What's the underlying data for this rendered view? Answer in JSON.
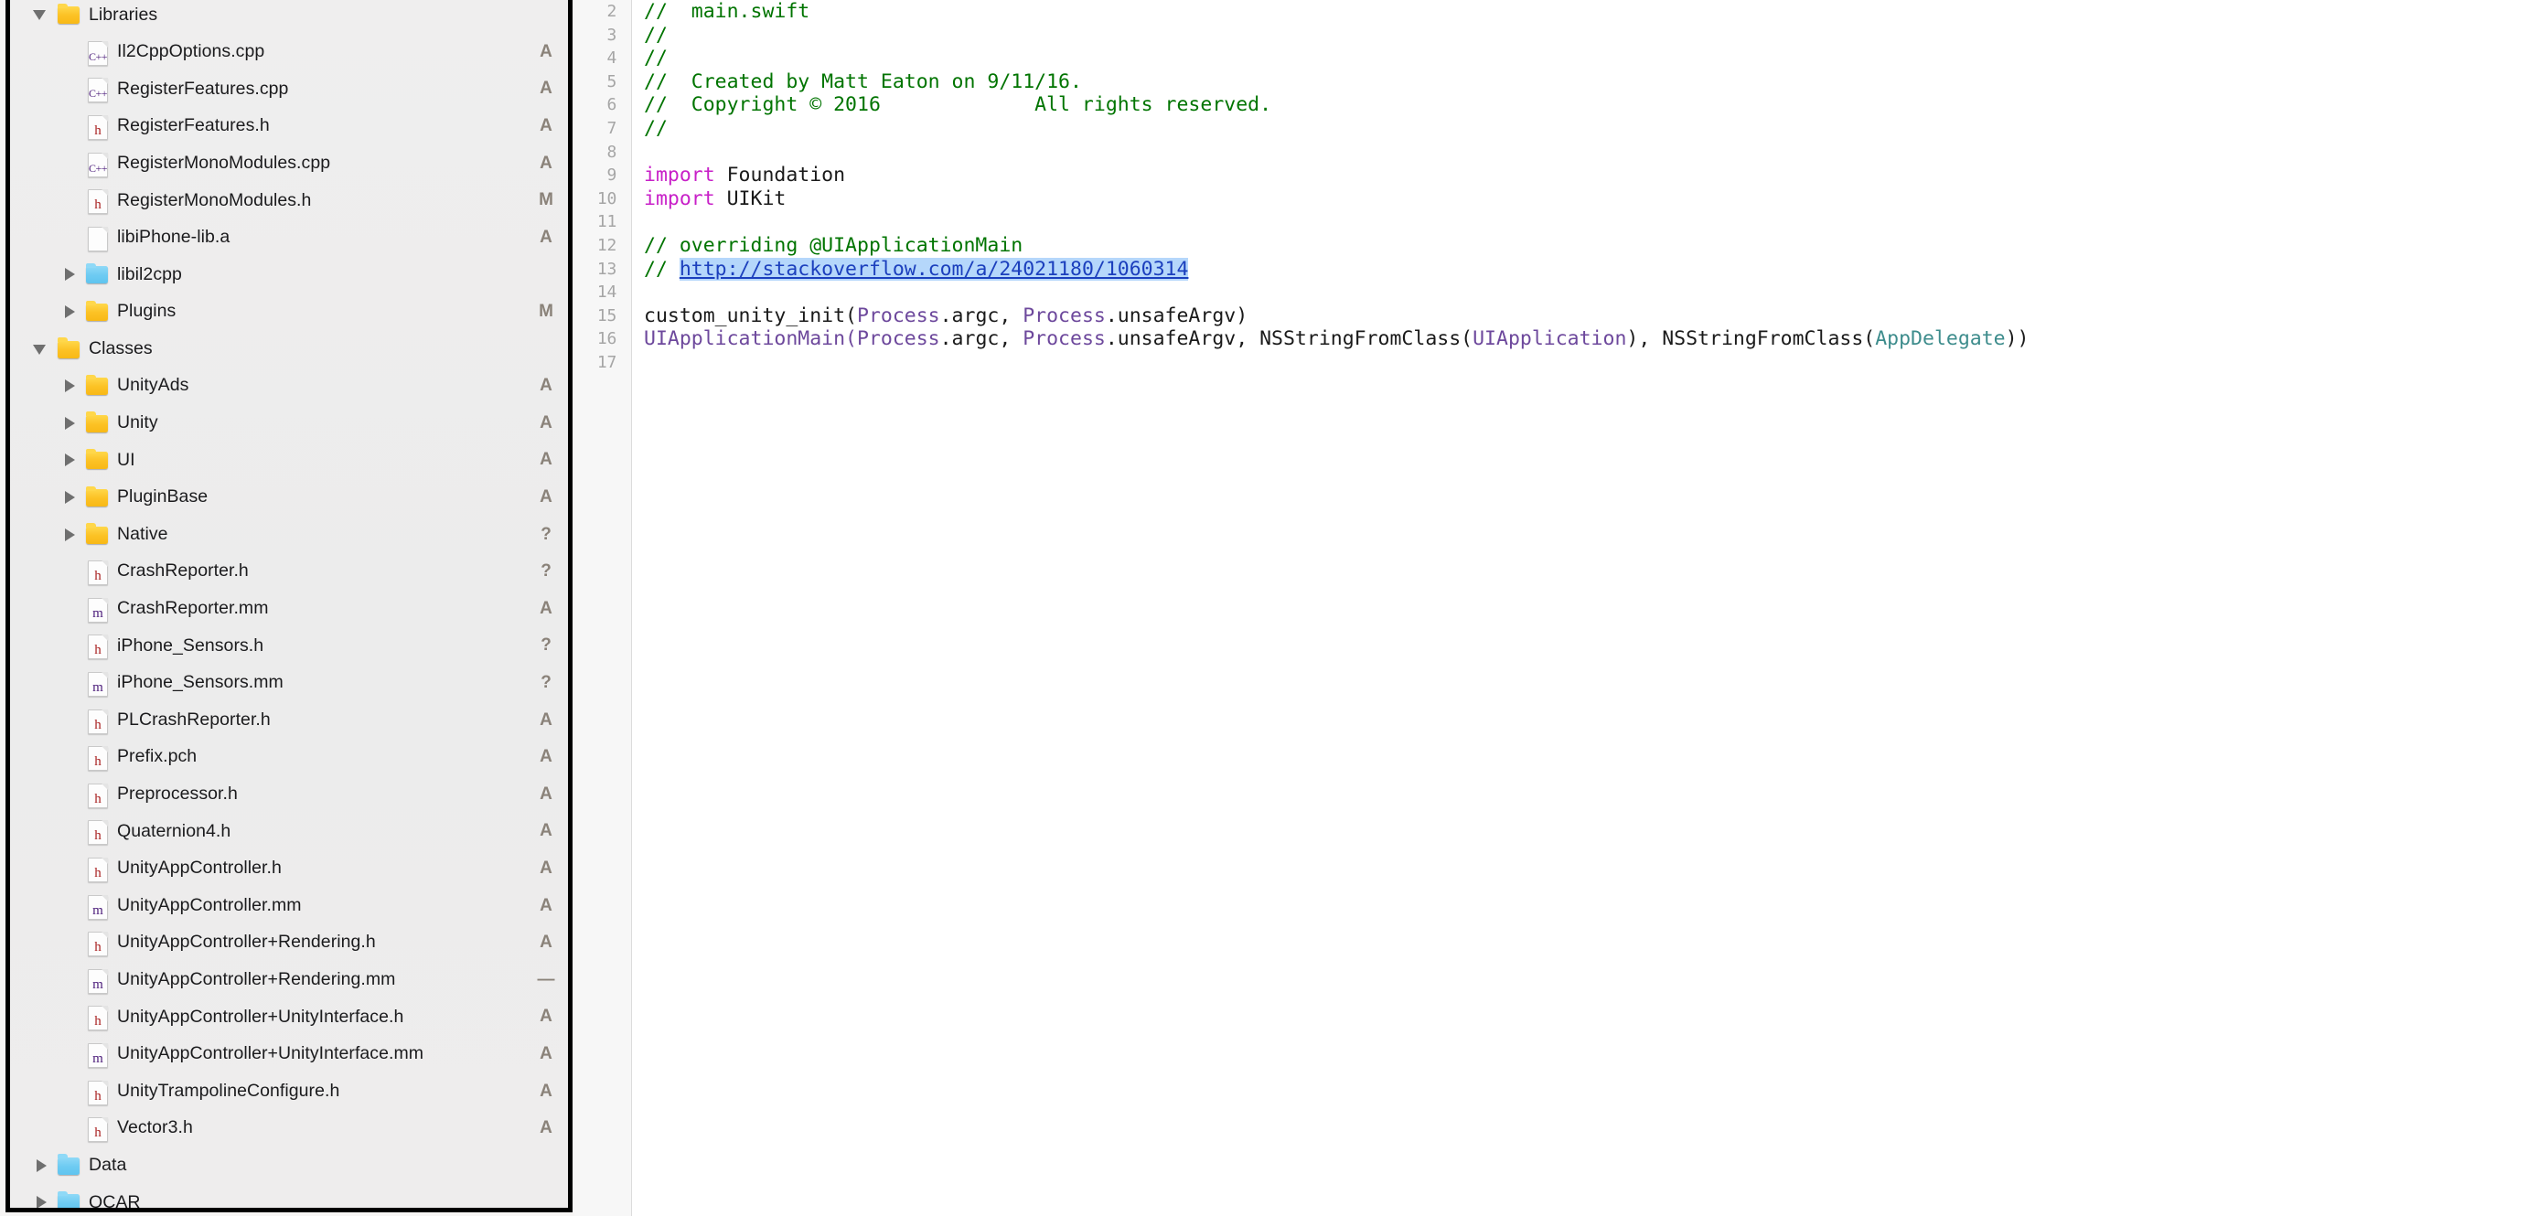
{
  "sidebar": {
    "name": "project-navigator",
    "scrollbar_visible": true,
    "rows": [
      {
        "label": "Libraries",
        "kind": "group",
        "icon": "folder-yellow",
        "twisty": "open",
        "indent": 0,
        "status": ""
      },
      {
        "label": "Il2CppOptions.cpp",
        "kind": "file",
        "icon": "file-cpp",
        "twisty": "none",
        "indent": 1,
        "status": "A"
      },
      {
        "label": "RegisterFeatures.cpp",
        "kind": "file",
        "icon": "file-cpp",
        "twisty": "none",
        "indent": 1,
        "status": "A"
      },
      {
        "label": "RegisterFeatures.h",
        "kind": "file",
        "icon": "file-h",
        "twisty": "none",
        "indent": 1,
        "status": "A"
      },
      {
        "label": "RegisterMonoModules.cpp",
        "kind": "file",
        "icon": "file-cpp",
        "twisty": "none",
        "indent": 1,
        "status": "A"
      },
      {
        "label": "RegisterMonoModules.h",
        "kind": "file",
        "icon": "file-h",
        "twisty": "none",
        "indent": 1,
        "status": "M"
      },
      {
        "label": "libiPhone-lib.a",
        "kind": "file",
        "icon": "file-blank",
        "twisty": "none",
        "indent": 1,
        "status": "A"
      },
      {
        "label": "libil2cpp",
        "kind": "folder-ref",
        "icon": "folder-blue",
        "twisty": "closed",
        "indent": 1,
        "status": ""
      },
      {
        "label": "Plugins",
        "kind": "group",
        "icon": "folder-yellow",
        "twisty": "closed",
        "indent": 1,
        "status": "M"
      },
      {
        "label": "Classes",
        "kind": "group",
        "icon": "folder-yellow",
        "twisty": "open",
        "indent": 0,
        "status": ""
      },
      {
        "label": "UnityAds",
        "kind": "group",
        "icon": "folder-yellow",
        "twisty": "closed",
        "indent": 1,
        "status": "A"
      },
      {
        "label": "Unity",
        "kind": "group",
        "icon": "folder-yellow",
        "twisty": "closed",
        "indent": 1,
        "status": "A"
      },
      {
        "label": "UI",
        "kind": "group",
        "icon": "folder-yellow",
        "twisty": "closed",
        "indent": 1,
        "status": "A"
      },
      {
        "label": "PluginBase",
        "kind": "group",
        "icon": "folder-yellow",
        "twisty": "closed",
        "indent": 1,
        "status": "A"
      },
      {
        "label": "Native",
        "kind": "group",
        "icon": "folder-yellow",
        "twisty": "closed",
        "indent": 1,
        "status": "?"
      },
      {
        "label": "CrashReporter.h",
        "kind": "file",
        "icon": "file-h",
        "twisty": "none",
        "indent": 1,
        "status": "?"
      },
      {
        "label": "CrashReporter.mm",
        "kind": "file",
        "icon": "file-m",
        "twisty": "none",
        "indent": 1,
        "status": "A"
      },
      {
        "label": "iPhone_Sensors.h",
        "kind": "file",
        "icon": "file-h",
        "twisty": "none",
        "indent": 1,
        "status": "?"
      },
      {
        "label": "iPhone_Sensors.mm",
        "kind": "file",
        "icon": "file-m",
        "twisty": "none",
        "indent": 1,
        "status": "?"
      },
      {
        "label": "PLCrashReporter.h",
        "kind": "file",
        "icon": "file-h",
        "twisty": "none",
        "indent": 1,
        "status": "A"
      },
      {
        "label": "Prefix.pch",
        "kind": "file",
        "icon": "file-h",
        "twisty": "none",
        "indent": 1,
        "status": "A"
      },
      {
        "label": "Preprocessor.h",
        "kind": "file",
        "icon": "file-h",
        "twisty": "none",
        "indent": 1,
        "status": "A"
      },
      {
        "label": "Quaternion4.h",
        "kind": "file",
        "icon": "file-h",
        "twisty": "none",
        "indent": 1,
        "status": "A"
      },
      {
        "label": "UnityAppController.h",
        "kind": "file",
        "icon": "file-h",
        "twisty": "none",
        "indent": 1,
        "status": "A"
      },
      {
        "label": "UnityAppController.mm",
        "kind": "file",
        "icon": "file-m",
        "twisty": "none",
        "indent": 1,
        "status": "A"
      },
      {
        "label": "UnityAppController+Rendering.h",
        "kind": "file",
        "icon": "file-h",
        "twisty": "none",
        "indent": 1,
        "status": "A"
      },
      {
        "label": "UnityAppController+Rendering.mm",
        "kind": "file",
        "icon": "file-m",
        "twisty": "none",
        "indent": 1,
        "status": "—"
      },
      {
        "label": "UnityAppController+UnityInterface.h",
        "kind": "file",
        "icon": "file-h",
        "twisty": "none",
        "indent": 1,
        "status": "A"
      },
      {
        "label": "UnityAppController+UnityInterface.mm",
        "kind": "file",
        "icon": "file-m",
        "twisty": "none",
        "indent": 1,
        "status": "A"
      },
      {
        "label": "UnityTrampolineConfigure.h",
        "kind": "file",
        "icon": "file-h",
        "twisty": "none",
        "indent": 1,
        "status": "A"
      },
      {
        "label": "Vector3.h",
        "kind": "file",
        "icon": "file-h",
        "twisty": "none",
        "indent": 1,
        "status": "A"
      },
      {
        "label": "Data",
        "kind": "folder-ref",
        "icon": "folder-blue",
        "twisty": "closed",
        "indent": 0,
        "status": ""
      },
      {
        "label": "QCAR",
        "kind": "folder-ref",
        "icon": "folder-blue",
        "twisty": "closed",
        "indent": 0,
        "status": ""
      }
    ]
  },
  "editor": {
    "name": "source-editor",
    "language": "swift",
    "first_visible_line": 2,
    "lines": [
      {
        "n": "2",
        "tokens": [
          {
            "t": "//  main.swift",
            "c": "cm"
          }
        ]
      },
      {
        "n": "3",
        "tokens": [
          {
            "t": "//",
            "c": "cm"
          }
        ]
      },
      {
        "n": "4",
        "tokens": [
          {
            "t": "//",
            "c": "cm"
          }
        ]
      },
      {
        "n": "5",
        "tokens": [
          {
            "t": "//  Created by Matt Eaton on 9/11/16.",
            "c": "cm"
          }
        ]
      },
      {
        "n": "6",
        "tokens": [
          {
            "t": "//  Copyright © 2016             All rights reserved.",
            "c": "cm"
          }
        ]
      },
      {
        "n": "7",
        "tokens": [
          {
            "t": "//",
            "c": "cm"
          }
        ]
      },
      {
        "n": "8",
        "tokens": []
      },
      {
        "n": "9",
        "tokens": [
          {
            "t": "import",
            "c": "kw"
          },
          {
            "t": " Foundation",
            "c": "pl"
          }
        ]
      },
      {
        "n": "10",
        "tokens": [
          {
            "t": "import",
            "c": "kw"
          },
          {
            "t": " UIKit",
            "c": "pl"
          }
        ]
      },
      {
        "n": "11",
        "tokens": []
      },
      {
        "n": "12",
        "tokens": [
          {
            "t": "// overriding @UIApplicationMain",
            "c": "cm"
          }
        ]
      },
      {
        "n": "13",
        "tokens": [
          {
            "t": "// ",
            "c": "cm"
          },
          {
            "t": "http://stackoverflow.com/a/24021180/1060314",
            "c": "urlsel"
          }
        ]
      },
      {
        "n": "14",
        "tokens": []
      },
      {
        "n": "15",
        "tokens": [
          {
            "t": "custom_unity_init(",
            "c": "pl"
          },
          {
            "t": "Process",
            "c": "ty"
          },
          {
            "t": ".argc, ",
            "c": "pl"
          },
          {
            "t": "Process",
            "c": "ty"
          },
          {
            "t": ".unsafeArgv)",
            "c": "pl"
          }
        ]
      },
      {
        "n": "16",
        "tokens": [
          {
            "t": "UIApplicationMain(",
            "c": "ty"
          },
          {
            "t": "Process",
            "c": "ty"
          },
          {
            "t": ".argc, ",
            "c": "pl"
          },
          {
            "t": "Process",
            "c": "ty"
          },
          {
            "t": ".unsafeArgv, NSStringFromClass(",
            "c": "pl"
          },
          {
            "t": "UIApplication",
            "c": "ty"
          },
          {
            "t": "), NSStringFromClass(",
            "c": "pl"
          },
          {
            "t": "AppDelegate",
            "c": "tyg",
            "teal": true
          },
          {
            "t": "))",
            "c": "pl"
          }
        ]
      },
      {
        "n": "17",
        "tokens": []
      }
    ]
  },
  "colors": {
    "comment_green": "#007400",
    "keyword_magenta": "#c820c8",
    "type_purple": "#6d489c",
    "class_teal": "#3d8c8c",
    "url_link": "#1b3fbd",
    "url_selection_bg": "#b5d7fb",
    "folder_yellow": "#fcc225",
    "folder_blue": "#6ecbf2",
    "status_letter": "#8a8279",
    "sidebar_bg": "#ececec",
    "gutter_bg": "#f7f7f7",
    "editor_bg": "#ffffff"
  }
}
